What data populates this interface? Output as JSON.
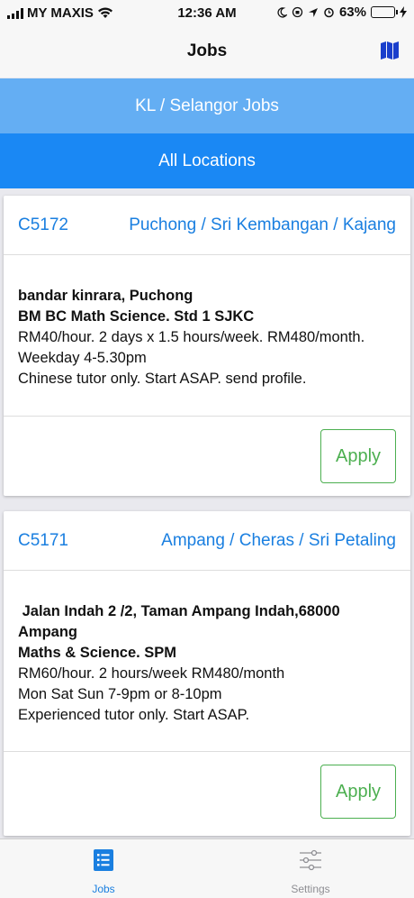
{
  "status": {
    "carrier": "MY MAXIS",
    "time": "12:36 AM",
    "battery": "63%",
    "battery_level": 0.63
  },
  "nav": {
    "title": "Jobs",
    "map_icon": "map-icon"
  },
  "segments": {
    "kl": "KL / Selangor Jobs",
    "all": "All Locations"
  },
  "jobs": [
    {
      "code": "C5172",
      "area": "Puchong / Sri Kembangan / Kajang",
      "location": "bandar kinrara, Puchong",
      "subjects": "BM BC Math Science. Std 1 SJKC",
      "details": [
        "RM40/hour. 2 days x 1.5 hours/week. RM480/month.",
        "Weekday 4-5.30pm",
        "Chinese tutor only. Start ASAP. send profile."
      ],
      "apply_label": "Apply"
    },
    {
      "code": "C5171",
      "area": "Ampang / Cheras / Sri Petaling",
      "location": " Jalan Indah 2 /2, Taman Ampang Indah,68000 Ampang",
      "subjects": "Maths & Science. SPM",
      "details": [
        "RM60/hour. 2 hours/week RM480/month",
        "Mon Sat Sun 7-9pm or 8-10pm",
        "Experienced tutor only. Start ASAP."
      ],
      "apply_label": "Apply"
    }
  ],
  "tabs": [
    {
      "label": "Jobs",
      "icon": "list-icon",
      "active": true
    },
    {
      "label": "Settings",
      "icon": "sliders-icon",
      "active": false
    }
  ],
  "colors": {
    "accent": "#1a7fe0",
    "segment_light": "#64aef3",
    "segment_dark": "#1a88f4",
    "apply_green": "#4caf50"
  }
}
